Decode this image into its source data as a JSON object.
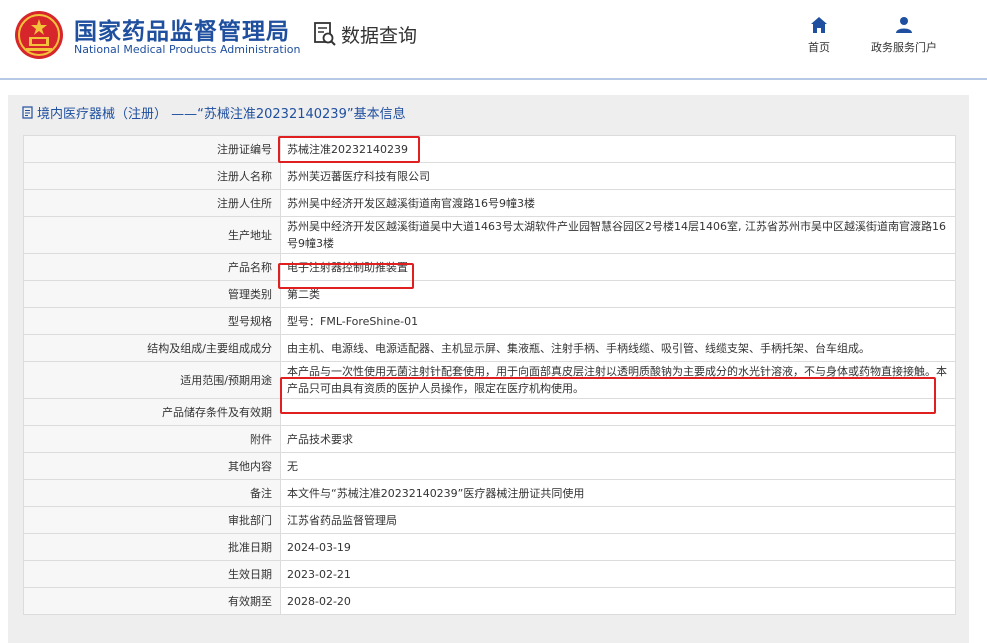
{
  "header": {
    "agency_name_cn": "国家药品监督管理局",
    "agency_name_en": "National Medical Products Administration",
    "query_label": "数据查询",
    "nav": [
      {
        "label": "首页",
        "icon": "home-icon"
      },
      {
        "label": "政务服务门户",
        "icon": "user-icon"
      }
    ]
  },
  "panel": {
    "title": "境内医疗器械（注册） ——“苏械注准20232140239”基本信息"
  },
  "records": [
    {
      "label": "注册证编号",
      "value": "苏械注准20232140239"
    },
    {
      "label": "注册人名称",
      "value": "苏州芙迈蕃医疗科技有限公司"
    },
    {
      "label": "注册人住所",
      "value": "苏州吴中经济开发区越溪街道南官渡路16号9幢3楼"
    },
    {
      "label": "生产地址",
      "value": "苏州吴中经济开发区越溪街道吴中大道1463号太湖软件产业园智慧谷园区2号楼14层1406室, 江苏省苏州市吴中区越溪街道南官渡路16号9幢3楼"
    },
    {
      "label": "产品名称",
      "value": "电子注射器控制助推装置"
    },
    {
      "label": "管理类别",
      "value": "第二类"
    },
    {
      "label": "型号规格",
      "value": "型号：FML-ForeShine-01"
    },
    {
      "label": "结构及组成/主要组成成分",
      "value": "由主机、电源线、电源适配器、主机显示屏、集液瓶、注射手柄、手柄线缆、吸引管、线缆支架、手柄托架、台车组成。"
    },
    {
      "label": "适用范围/预期用途",
      "value": "本产品与一次性使用无菌注射针配套使用，用于向面部真皮层注射以透明质酸钠为主要成分的水光针溶液，不与身体或药物直接接触。本产品只可由具有资质的医护人员操作，限定在医疗机构使用。"
    },
    {
      "label": "产品储存条件及有效期",
      "value": ""
    },
    {
      "label": "附件",
      "value": "产品技术要求"
    },
    {
      "label": "其他内容",
      "value": "无"
    },
    {
      "label": "备注",
      "value": "本文件与“苏械注准20232140239”医疗器械注册证共同使用"
    },
    {
      "label": "审批部门",
      "value": "江苏省药品监督管理局"
    },
    {
      "label": "批准日期",
      "value": "2024-03-19"
    },
    {
      "label": "生效日期",
      "value": "2023-02-21"
    },
    {
      "label": "有效期至",
      "value": "2028-02-20"
    }
  ],
  "colors": {
    "brand_blue": "#1f4f9f",
    "highlight_red": "#e02020"
  }
}
